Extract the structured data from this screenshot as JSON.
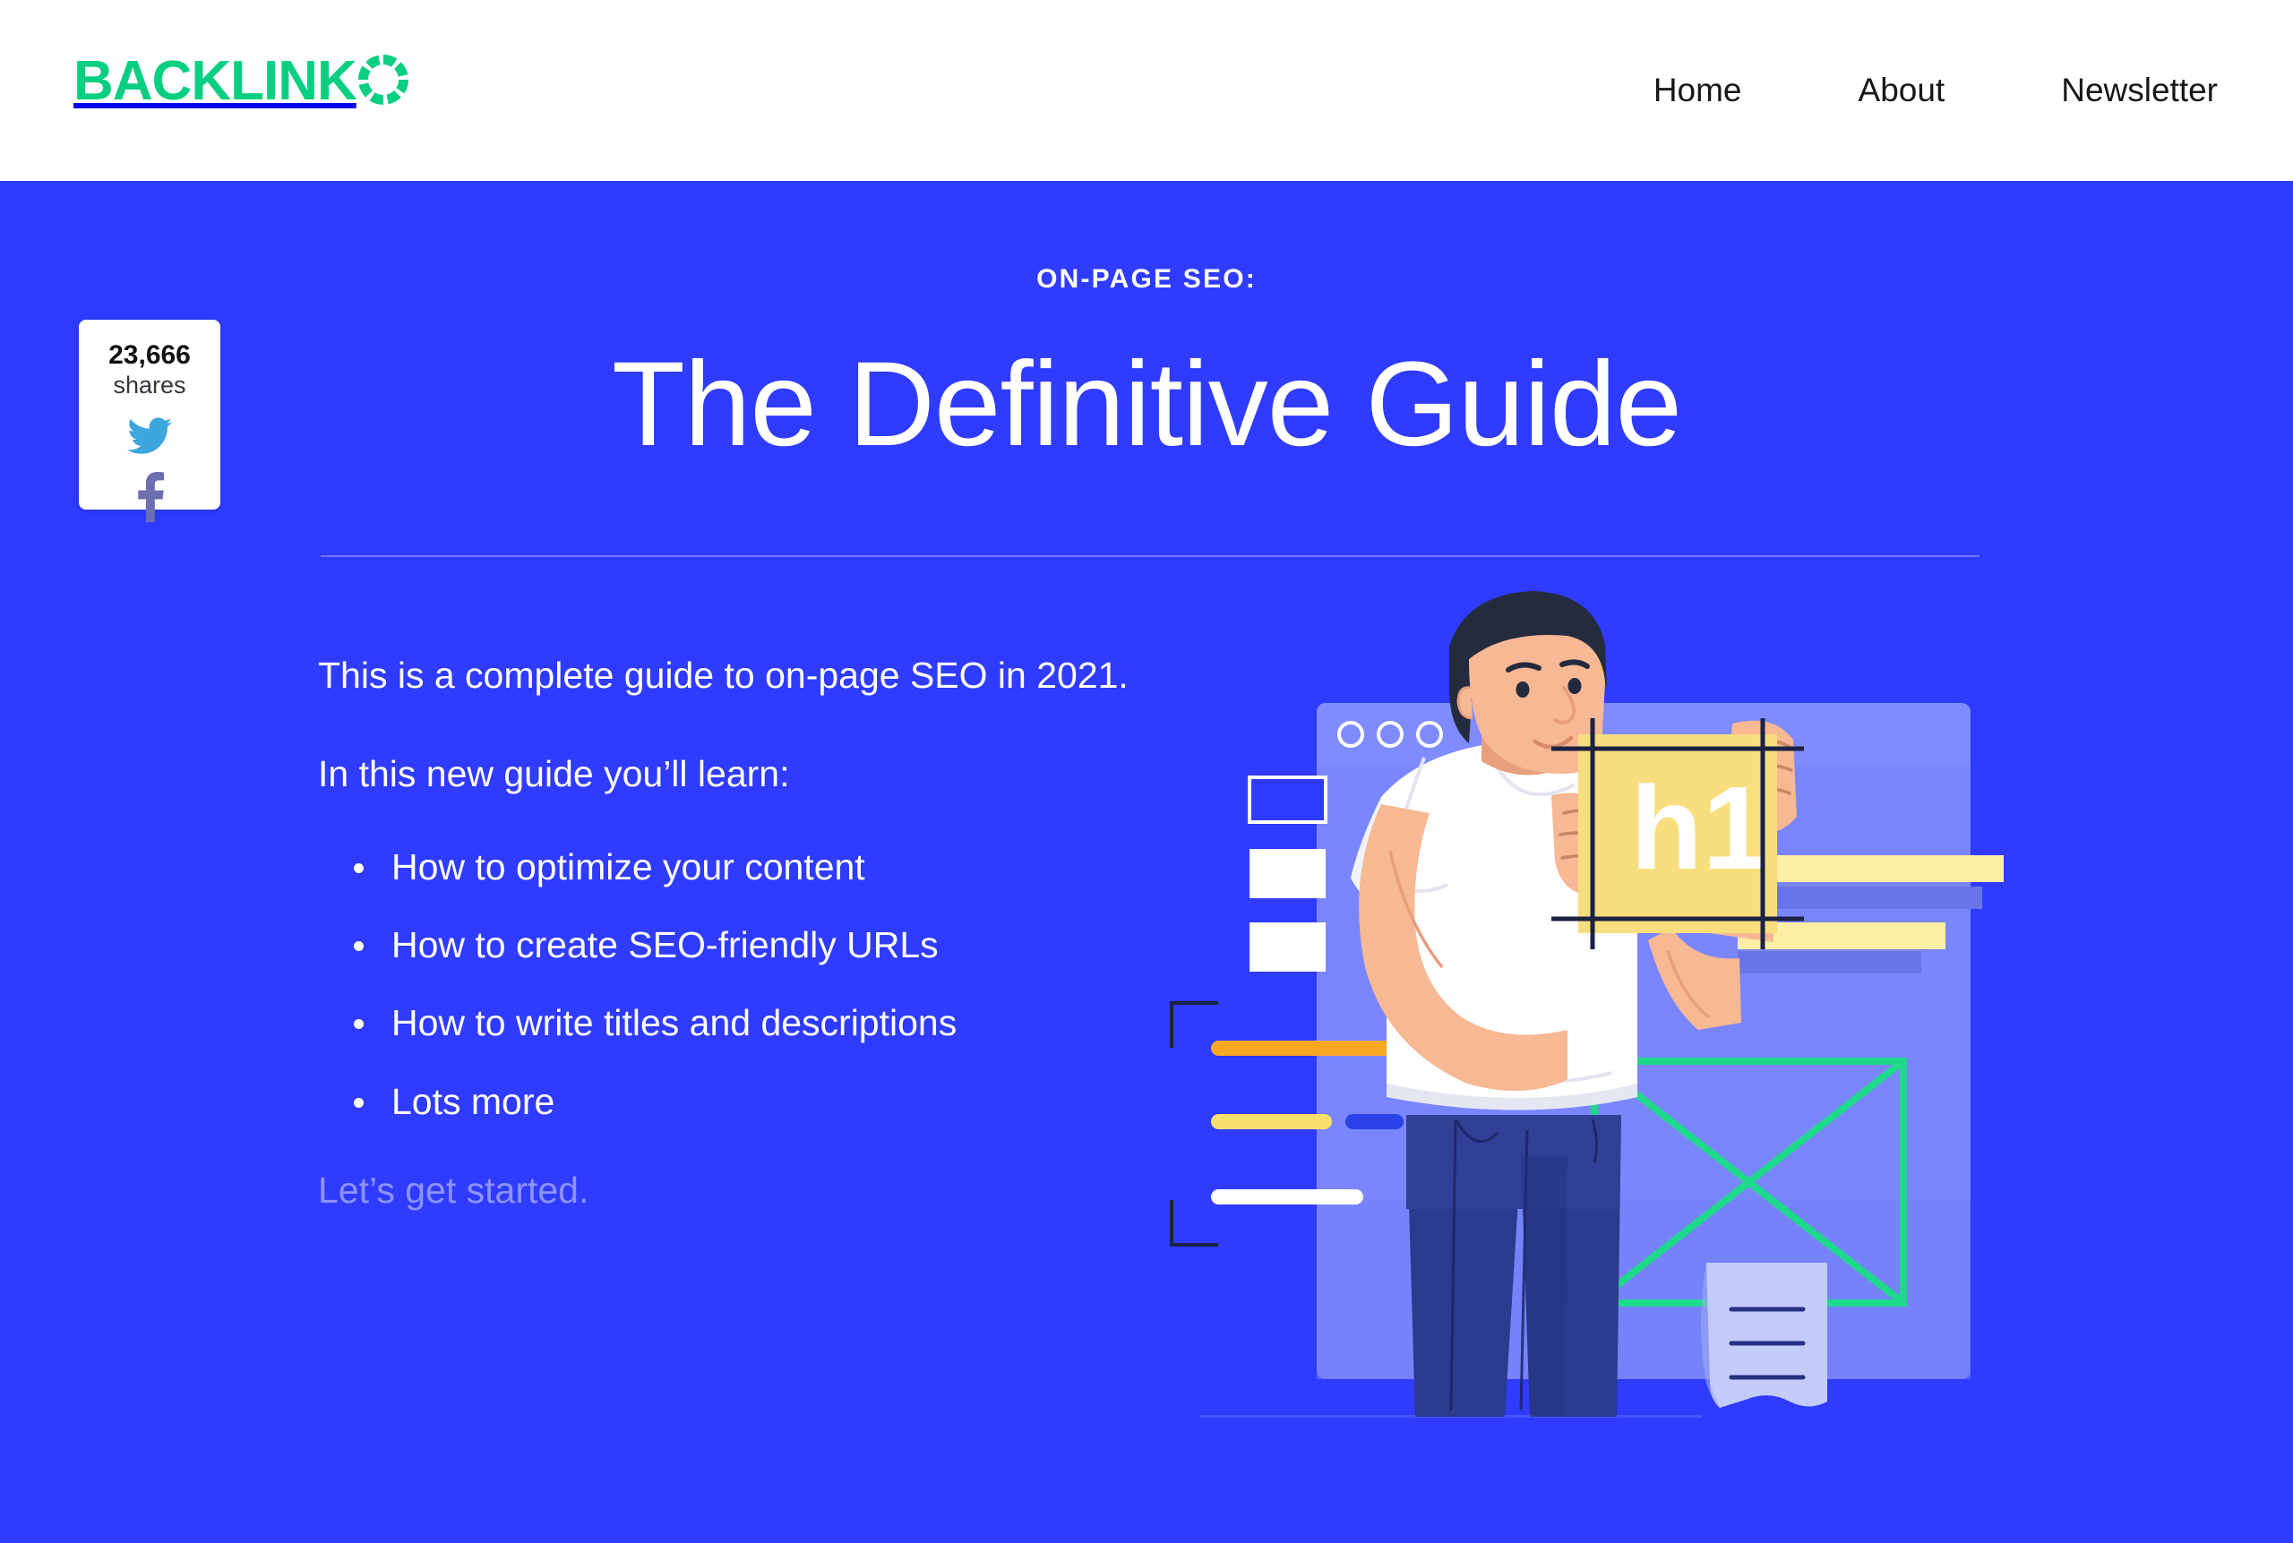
{
  "header": {
    "logo": {
      "text": "BACKLINK",
      "ring_icon": "segmented-ring-icon",
      "color": "#0ACF83"
    },
    "nav": [
      {
        "label": "Home"
      },
      {
        "label": "About"
      },
      {
        "label": "Newsletter"
      }
    ]
  },
  "hero": {
    "background_color": "#2F3BFF",
    "eyebrow": "ON-PAGE SEO:",
    "title": "The Definitive Guide",
    "paragraphs": [
      "This is a complete guide to on-page SEO in 2021.",
      "In this new guide you’ll learn:"
    ],
    "bullets": [
      "How to optimize your content",
      "How to create SEO-friendly URLs",
      "How to write titles and descriptions",
      "Lots more"
    ],
    "outro": "Let’s get started."
  },
  "share_widget": {
    "count": "23,666",
    "label": "shares",
    "buttons": [
      {
        "name": "twitter-share-button",
        "icon": "twitter-bird-icon",
        "color": "#3DA6DE"
      },
      {
        "name": "facebook-share-button",
        "icon": "facebook-f-icon",
        "color": "#6C6FAF"
      }
    ]
  },
  "illustration": {
    "name": "on-page-seo-hero-illustration",
    "card_label": "h1",
    "card_color": "#F8DE7E",
    "browser_dots": 3,
    "bars": [
      {
        "name": "orange-bar",
        "color": "#F7A823"
      },
      {
        "name": "yellow-bar",
        "color": "#F9E06B"
      },
      {
        "name": "white-bar",
        "color": "#FFFFFF"
      },
      {
        "name": "blue-bar",
        "color": "#2B42E8"
      }
    ],
    "accent_green": "#1FD98A",
    "panel_color": "#7986FF",
    "shirt_color": "#FFFFFF",
    "pants_color": "#2B3A8C",
    "skin_color": "#F7B894",
    "hair_color": "#242B3D"
  }
}
